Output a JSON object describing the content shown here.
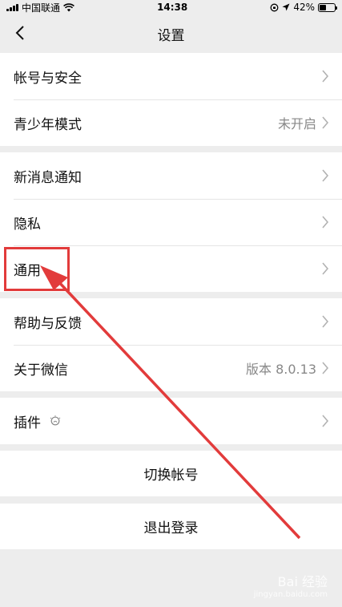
{
  "status_bar": {
    "carrier": "中国联通",
    "time": "14:38",
    "battery": "42%",
    "battery_level": 0.42
  },
  "nav": {
    "title": "设置"
  },
  "groups": [
    [
      {
        "label": "帐号与安全",
        "value": ""
      },
      {
        "label": "青少年模式",
        "value": "未开启"
      }
    ],
    [
      {
        "label": "新消息通知",
        "value": ""
      },
      {
        "label": "隐私",
        "value": ""
      },
      {
        "label": "通用",
        "value": ""
      }
    ],
    [
      {
        "label": "帮助与反馈",
        "value": ""
      },
      {
        "label": "关于微信",
        "value": "版本 8.0.13"
      }
    ],
    [
      {
        "label": "插件",
        "value": ""
      }
    ]
  ],
  "actions": {
    "switch_account": "切换帐号",
    "logout": "退出登录"
  },
  "watermark": {
    "brand": "Bai 经验",
    "url": "jingyan.baidu.com"
  },
  "colors": {
    "background": "#ededed",
    "highlight": "#e23b3b"
  }
}
